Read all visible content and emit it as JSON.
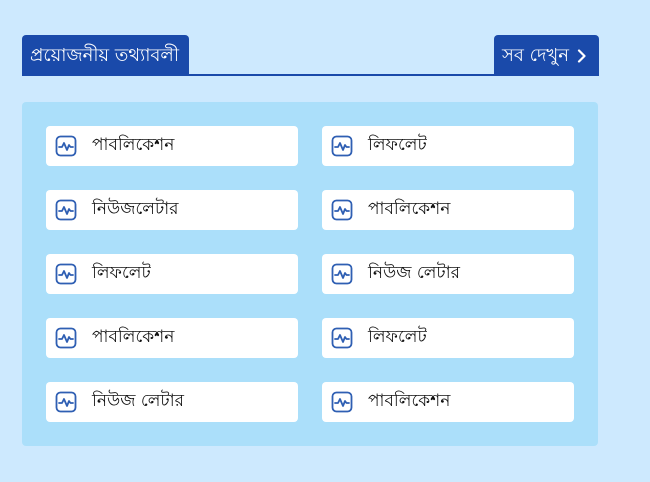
{
  "header": {
    "title": "প্রয়োজনীয় তথ্যাবলী",
    "see_all_label": "সব দেখুন"
  },
  "items": [
    {
      "label": "পাবলিকেশন",
      "icon": "activity-chart-icon"
    },
    {
      "label": "লিফলেট",
      "icon": "activity-chart-icon"
    },
    {
      "label": "নিউজলেটার",
      "icon": "activity-chart-icon"
    },
    {
      "label": "পাবলিকেশন",
      "icon": "activity-chart-icon"
    },
    {
      "label": "লিফলেট",
      "icon": "activity-chart-icon"
    },
    {
      "label": "নিউজ লেটার",
      "icon": "activity-chart-icon"
    },
    {
      "label": "পাবলিকেশন",
      "icon": "activity-chart-icon"
    },
    {
      "label": "লিফলেট",
      "icon": "activity-chart-icon"
    },
    {
      "label": "নিউজ লেটার",
      "icon": "activity-chart-icon"
    },
    {
      "label": "পাবলিকেশন",
      "icon": "activity-chart-icon"
    }
  ],
  "colors": {
    "background": "#cde9fe",
    "panel": "#abdffa",
    "accent": "#1a4aaa",
    "icon": "#2f5fb3"
  }
}
